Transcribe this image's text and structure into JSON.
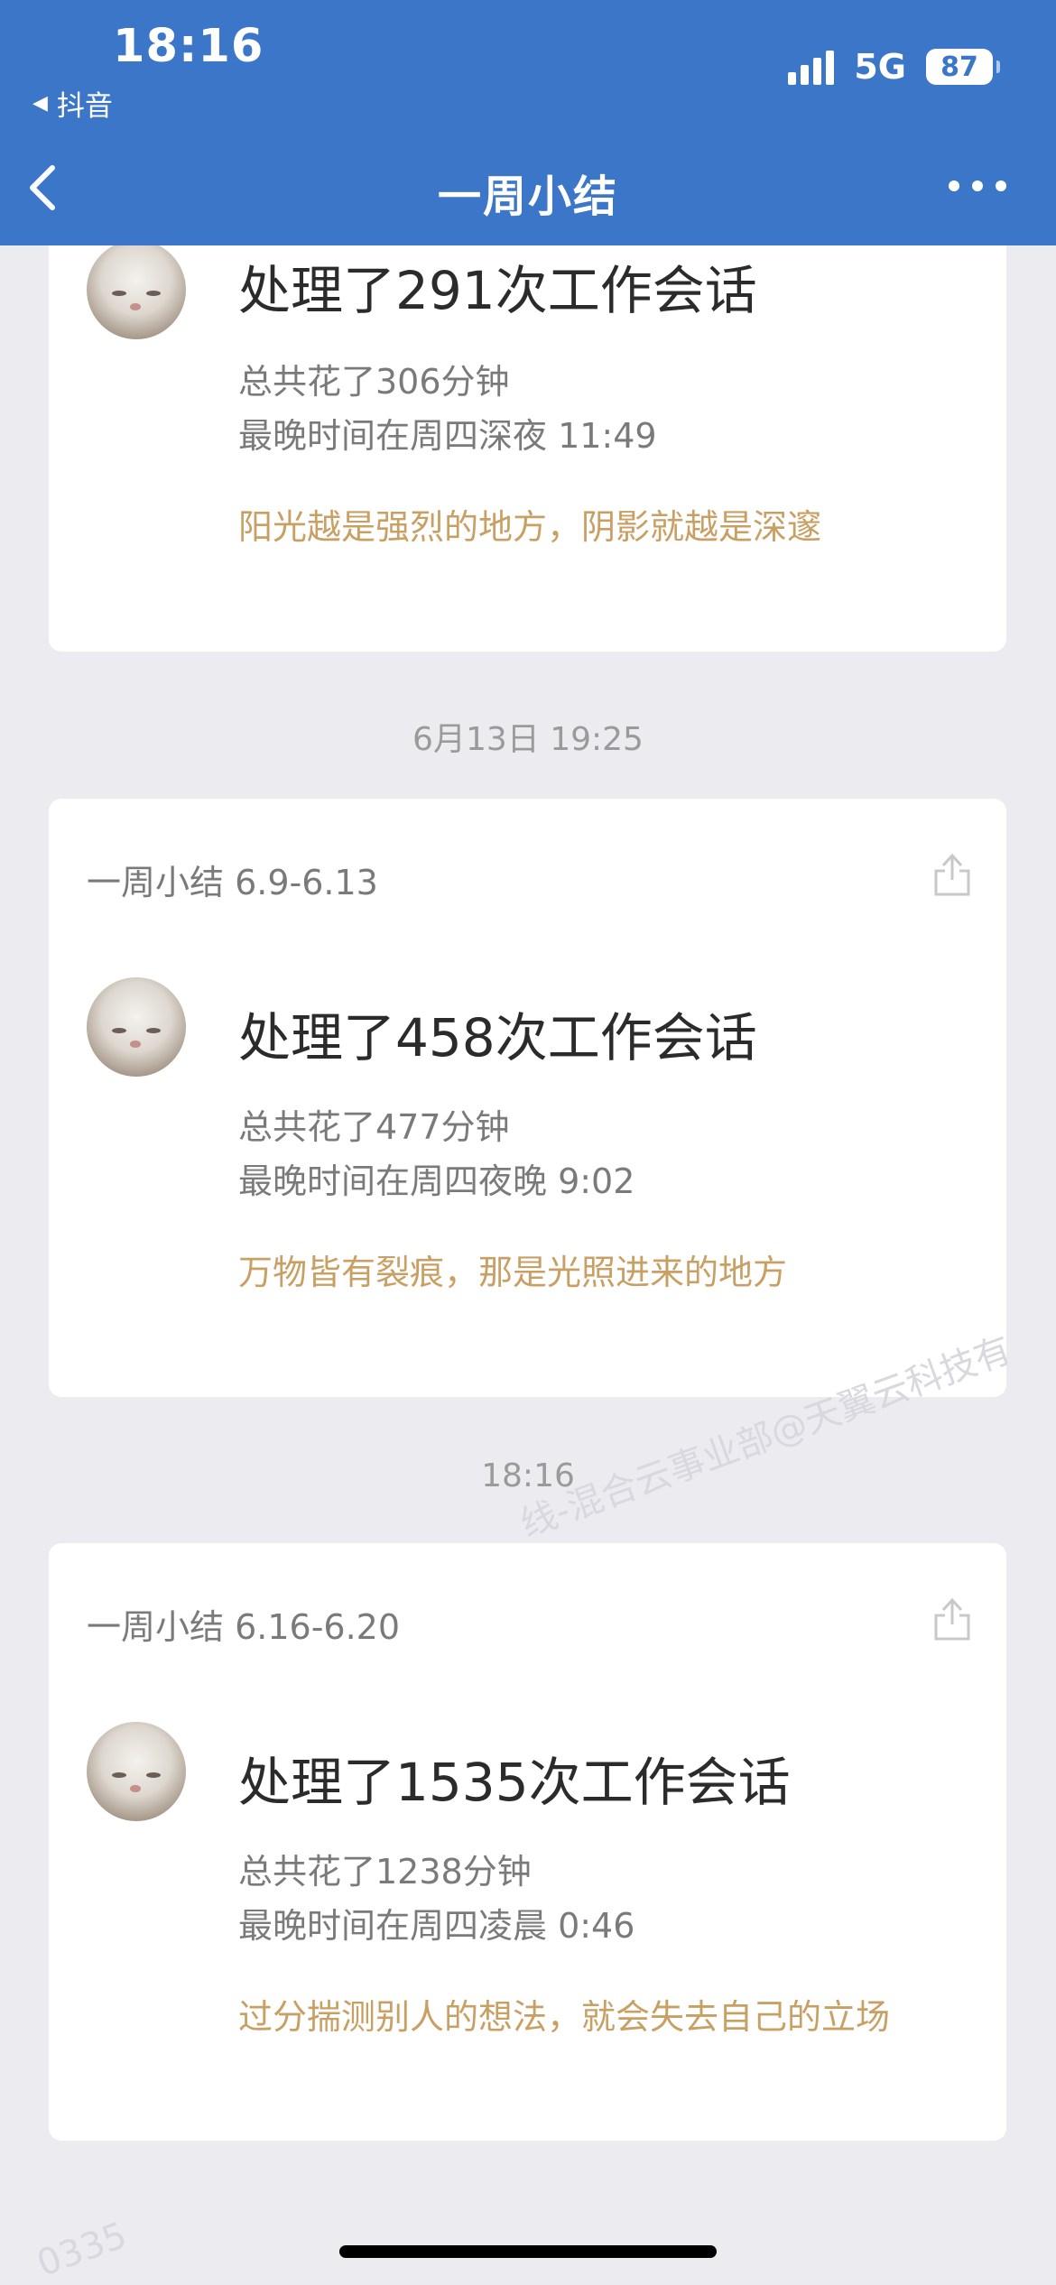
{
  "status_bar": {
    "time": "18:16",
    "back_app": "抖音",
    "network": "5G",
    "battery": "87"
  },
  "nav": {
    "title": "一周小结"
  },
  "cards": [
    {
      "headline": "处理了291次工作会话",
      "total": "总共花了306分钟",
      "latest": "最晚时间在周四深夜 11:49",
      "quote": "阳光越是强烈的地方，阴影就越是深邃"
    },
    {
      "subtitle": "一周小结 6.9-6.13",
      "headline": "处理了458次工作会话",
      "total": "总共花了477分钟",
      "latest": "最晚时间在周四夜晚 9:02",
      "quote": "万物皆有裂痕，那是光照进来的地方"
    },
    {
      "subtitle": "一周小结 6.16-6.20",
      "headline": "处理了1535次工作会话",
      "total": "总共花了1238分钟",
      "latest": "最晚时间在周四凌晨 0:46",
      "quote": "过分揣测别人的想法，就会失去自己的立场"
    }
  ],
  "timestamps": [
    "6月13日 19:25",
    "18:16"
  ],
  "watermarks": [
    "线-混合云事业部@天翼云科技有",
    "0335"
  ],
  "colors": {
    "header": "#3b76c8",
    "quote": "#c9a064",
    "background": "#ececf0"
  }
}
